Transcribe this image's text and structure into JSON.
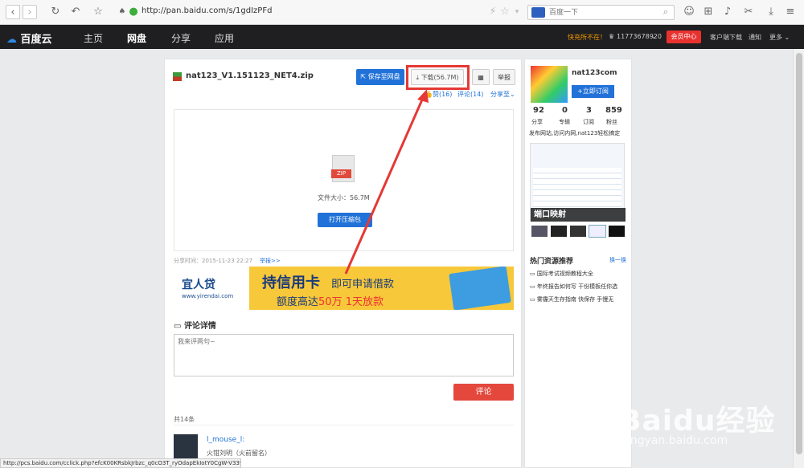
{
  "browser": {
    "url": "http://pan.baidu.com/s/1gdIzPFd",
    "search_placeholder": "百度一下"
  },
  "appnav": {
    "logo": "百度云",
    "items": [
      "主页",
      "网盘",
      "分享",
      "应用"
    ],
    "promo": "快充所不在！",
    "user": "11773678920",
    "vip": "会员中心",
    "client": "客户端下载",
    "notice": "通知",
    "more": "更多"
  },
  "file": {
    "name": "nat123_V1.151123_NET4.zip",
    "save": "保存至网盘",
    "download": "下载(56.7M)",
    "report": "举报",
    "like": "赞(16)",
    "comment": "评论(14)",
    "share": "分享至",
    "size": "文件大小：56.7M",
    "open": "打开压缩包",
    "zip_tag": "ZIP",
    "share_time": "分享时间：2015-11-23 22:27",
    "report_link": "举报>>"
  },
  "ad": {
    "brand": "宜人贷",
    "brand_url": "www.yirendai.com",
    "headline1": "持信用卡",
    "headline2": "即可申请借款",
    "sub1": "额度高达",
    "sub2": "50万",
    "sub3": "1天放款"
  },
  "comments": {
    "title": "评论详情",
    "placeholder": "我来评两句~",
    "submit": "评论",
    "count": "共14条",
    "first_user": "l_mouse_l:",
    "first_text": "火钳刘明（火前留名）"
  },
  "sidebar": {
    "username": "nat123com",
    "subscribe": "+立即订阅",
    "stats": [
      {
        "n": "92",
        "l": "分享"
      },
      {
        "n": "0",
        "l": "专辑"
      },
      {
        "n": "3",
        "l": "订阅"
      },
      {
        "n": "859",
        "l": "粉丝"
      }
    ],
    "desc": "发布网站,访问内网,nat123轻松搞定",
    "thumb_caption": "端口映射",
    "hot_title": "热门资源推荐",
    "hot_switch": "换一换",
    "hot_items": [
      "国际考试视频教程大全",
      "年终报告如何写 干份模板任你选",
      "雾霾天生存指南 快保存 手慢无"
    ]
  },
  "status": "http://pcs.baidu.com/cclick.php?efcK00KRsbkJrbzc_q0cO3T_ryOdapEkIotY0CgW-V3394...",
  "watermark": {
    "brand": "Baidu经验",
    "url": "jingyan.baidu.com"
  },
  "colors": {
    "highlight": "#e53935",
    "accent": "#2172d8"
  }
}
